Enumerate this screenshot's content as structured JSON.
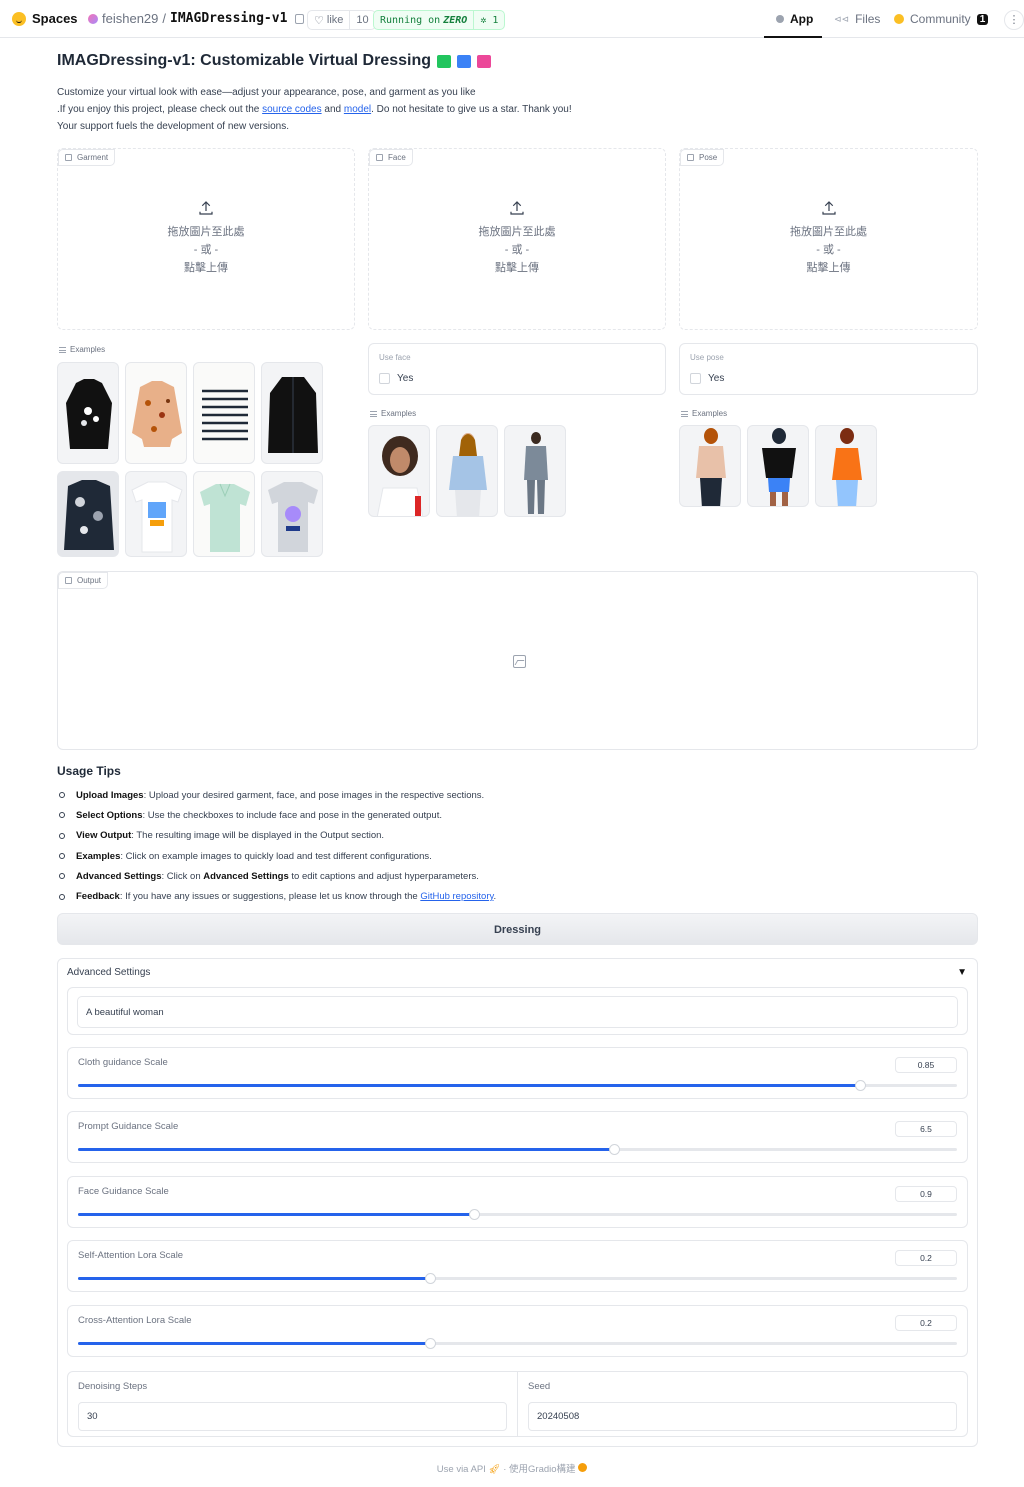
{
  "topbar": {
    "brand": "Spaces",
    "owner": "feishen29",
    "separator": "/",
    "repo": "IMAGDressing-v1",
    "like_label": "like",
    "like_count": "10",
    "running_label": "Running on",
    "running_hw": "ZERO",
    "running_count": "1",
    "tabs": [
      {
        "label": "App"
      },
      {
        "label": "Files"
      },
      {
        "label": "Community",
        "badge": "1"
      }
    ]
  },
  "title": "IMAGDressing-v1: Customizable Virtual Dressing",
  "description": {
    "line1": "Customize your virtual look with ease—adjust your appearance, pose, and garment as you like",
    "line2_pre": ".If you enjoy this project, please check out the ",
    "line2_link1": "source codes",
    "line2_mid": " and ",
    "line2_link2": "model",
    "line2_post": ". Do not hesitate to give us a star. Thank you!",
    "line3": "Your support fuels the development of new versions."
  },
  "panels": {
    "garment_label": "Garment",
    "face_label": "Face",
    "pose_label": "Pose",
    "upload_line1": "拖放圖片至此處",
    "upload_line2": "- 或 -",
    "upload_line3": "點擊上傳",
    "examples_label": "Examples",
    "use_face_label": "Use face",
    "use_pose_label": "Use pose",
    "yes_label": "Yes",
    "output_label": "Output"
  },
  "usage": {
    "title": "Usage Tips",
    "tips": [
      {
        "bold": "Upload Images",
        "text": ": Upload your desired garment, face, and pose images in the respective sections."
      },
      {
        "bold": "Select Options",
        "text": ": Use the checkboxes to include face and pose in the generated output."
      },
      {
        "bold": "View Output",
        "text": ": The resulting image will be displayed in the Output section."
      },
      {
        "bold": "Examples",
        "text": ": Click on example images to quickly load and test different configurations."
      },
      {
        "bold": "Advanced Settings",
        "text": ": Click on ",
        "bold2": "Advanced Settings",
        "text2": " to edit captions and adjust hyperparameters."
      },
      {
        "bold": "Feedback",
        "text": ": If you have any issues or suggestions, please let us know through the ",
        "link": "GitHub repository",
        "text2": "."
      }
    ]
  },
  "dress_button": "Dressing",
  "advanced": {
    "title": "Advanced Settings",
    "arrow": "▼",
    "prompt": "A beautiful woman",
    "sliders": [
      {
        "label": "Cloth guidance Scale",
        "value": "0.85",
        "fraction": 0.89
      },
      {
        "label": "Prompt Guidance Scale",
        "value": "6.5",
        "fraction": 0.61
      },
      {
        "label": "Face Guidance Scale",
        "value": "0.9",
        "fraction": 0.45
      },
      {
        "label": "Self-Attention Lora Scale",
        "value": "0.2",
        "fraction": 0.4
      },
      {
        "label": "Cross-Attention Lora Scale",
        "value": "0.2",
        "fraction": 0.4
      }
    ],
    "denoising_label": "Denoising Steps",
    "denoising_value": "30",
    "seed_label": "Seed",
    "seed_value": "20240508"
  },
  "footer": {
    "api": "Use via API",
    "dot": "·",
    "built": "使用Gradio構建"
  }
}
